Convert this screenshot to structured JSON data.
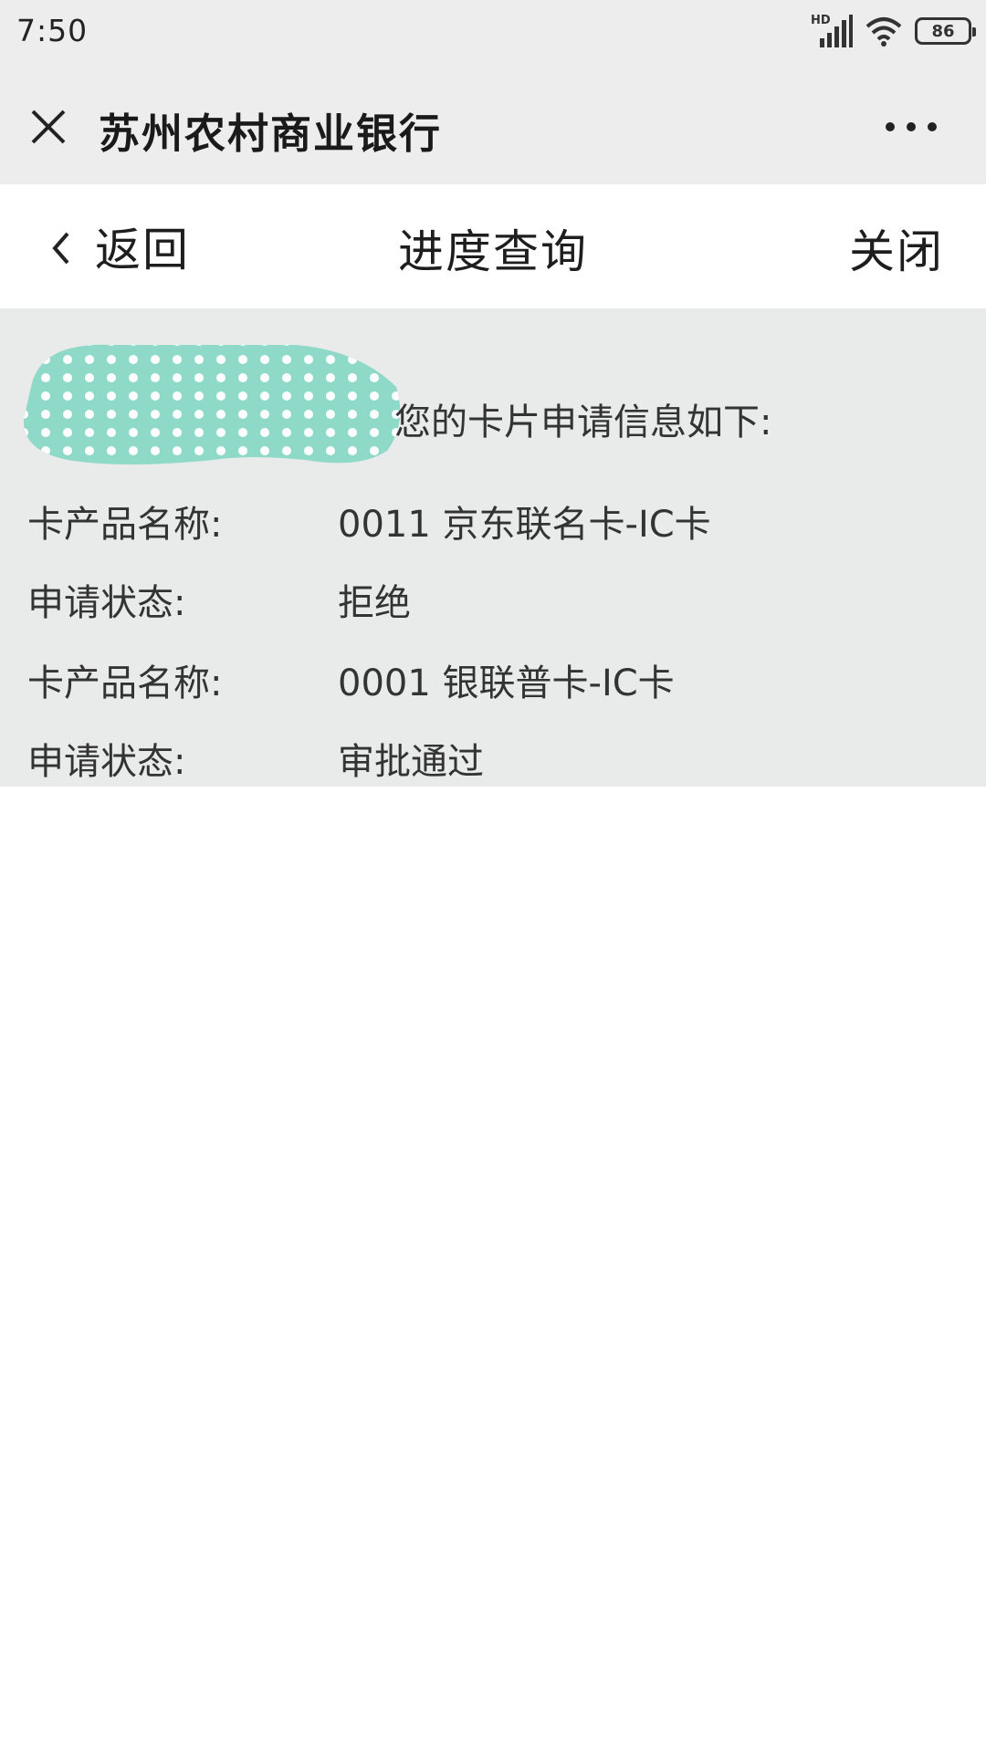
{
  "status_bar": {
    "time": "7:50",
    "network": "HD",
    "battery": "86"
  },
  "title_bar": {
    "title": "苏州农村商业银行"
  },
  "header": {
    "back_label": "返回",
    "title": "进度查询",
    "close_label": "关闭"
  },
  "content": {
    "intro": "您的卡片申请信息如下:",
    "records": [
      {
        "product_label": "卡产品名称:",
        "product_value": "0011 京东联名卡-IC卡",
        "status_label": "申请状态:",
        "status_value": "拒绝"
      },
      {
        "product_label": "卡产品名称:",
        "product_value": "0001 银联普卡-IC卡",
        "status_label": "申请状态:",
        "status_value": "审批通过"
      }
    ]
  },
  "colors": {
    "chrome_bg": "#ededed",
    "content_bg": "#e9eaea",
    "redaction": "#8fd9c8"
  }
}
